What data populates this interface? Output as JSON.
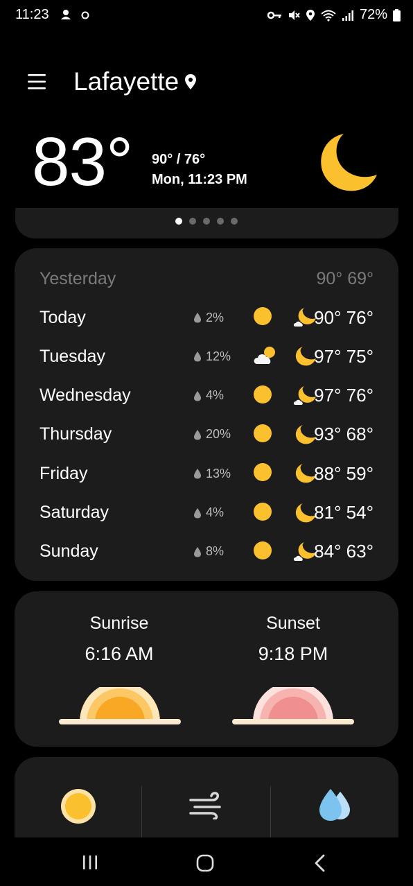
{
  "status_bar": {
    "time": "11:23",
    "battery": "72%"
  },
  "header": {
    "city": "Lafayette"
  },
  "current": {
    "temp": "83°",
    "hi_lo": "90° / 76°",
    "datetime": "Mon, 11:23 PM"
  },
  "forecast": {
    "yesterday": {
      "label": "Yesterday",
      "temps": "90° 69°"
    },
    "days": [
      {
        "day": "Today",
        "precip": "2%",
        "day_icon": "sun",
        "night_icon": "moon-cloud",
        "temps": "90° 76°"
      },
      {
        "day": "Tuesday",
        "precip": "12%",
        "day_icon": "cloud-sun",
        "night_icon": "moon",
        "temps": "97° 75°"
      },
      {
        "day": "Wednesday",
        "precip": "4%",
        "day_icon": "sun",
        "night_icon": "moon-cloud",
        "temps": "97° 76°"
      },
      {
        "day": "Thursday",
        "precip": "20%",
        "day_icon": "sun",
        "night_icon": "moon",
        "temps": "93° 68°"
      },
      {
        "day": "Friday",
        "precip": "13%",
        "day_icon": "sun",
        "night_icon": "moon",
        "temps": "88° 59°"
      },
      {
        "day": "Saturday",
        "precip": "4%",
        "day_icon": "sun",
        "night_icon": "moon",
        "temps": "81° 54°"
      },
      {
        "day": "Sunday",
        "precip": "8%",
        "day_icon": "sun",
        "night_icon": "moon-cloud",
        "temps": "84° 63°"
      }
    ]
  },
  "sun": {
    "sunrise_label": "Sunrise",
    "sunrise_time": "6:16 AM",
    "sunset_label": "Sunset",
    "sunset_time": "9:18 PM"
  },
  "colors": {
    "sun": "#fbc02d",
    "card_bg": "#1c1c1c",
    "sunset_pink": "#ef8f8f",
    "water_blue": "#7cc4ef"
  }
}
